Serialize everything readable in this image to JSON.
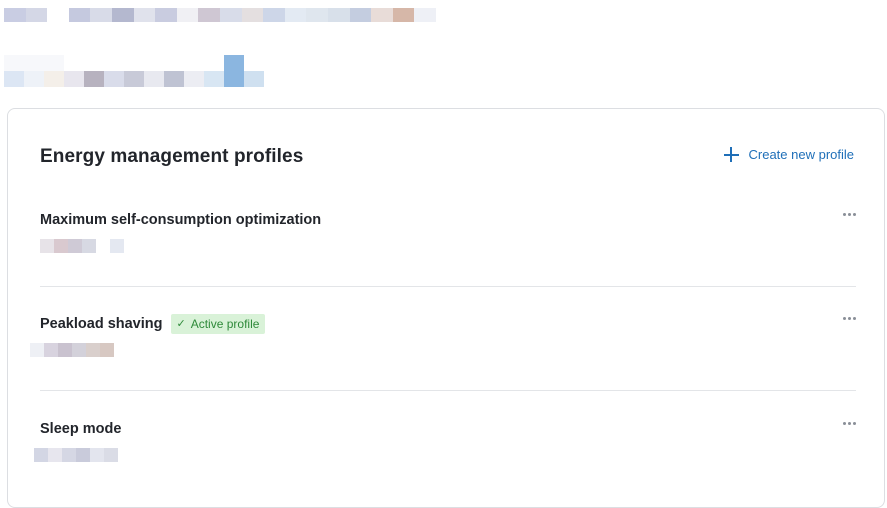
{
  "header": {
    "blurred_title_colors": [
      "#c9cde3",
      "#d4d7e6",
      "#ffffff",
      "#c5c9df",
      "#d8dbe8",
      "#b4b8cf",
      "#e0e2ec",
      "#c9cce0",
      "#f0f0f4",
      "#cfc7d3",
      "#d8dce9",
      "#e4dfe0",
      "#cdd6e8",
      "#e3eaf3",
      "#dfe6ee",
      "#d8e0ea",
      "#c4cde0",
      "#e8dcd8",
      "#d6b7a8",
      "#eef0f6"
    ],
    "blurred_subtitle_colors": [
      "#dce6f4",
      "#eef2f8",
      "#f4efe9",
      "#e8e6ee",
      "#b7b2bf",
      "#d9dcea",
      "#c8cad8",
      "#e8e9f0",
      "#bfc3d3",
      "#ecedf3",
      "#d8e6f3",
      "#8bb6e0",
      "#cfe0f0"
    ]
  },
  "card": {
    "title": "Energy management profiles",
    "create_label": "Create new profile",
    "profiles": [
      {
        "name": "Maximum self-consumption optimization",
        "active": false,
        "blur_colors": [
          "#e7e3e8",
          "#d9c9cf",
          "#cfcad6",
          "#d7d9e3",
          "#ffffff",
          "#e4e8f1"
        ]
      },
      {
        "name": "Peakload shaving",
        "active": true,
        "badge_label": "Active profile",
        "blur_colors": [
          "#eef0f5",
          "#d8d3df",
          "#c9c2cf",
          "#d3d1da",
          "#d9cfcc",
          "#d7c8c2"
        ]
      },
      {
        "name": "Sleep mode",
        "active": false,
        "blur_colors": [
          "#d3d6e4",
          "#e7e6ee",
          "#d5d7e4",
          "#c9cbdb",
          "#e3e5ee",
          "#dadce6"
        ]
      }
    ]
  },
  "colors": {
    "accent": "#1f6fb8",
    "active_badge_bg": "#d9f2d8",
    "active_badge_text": "#2f8a3a"
  }
}
